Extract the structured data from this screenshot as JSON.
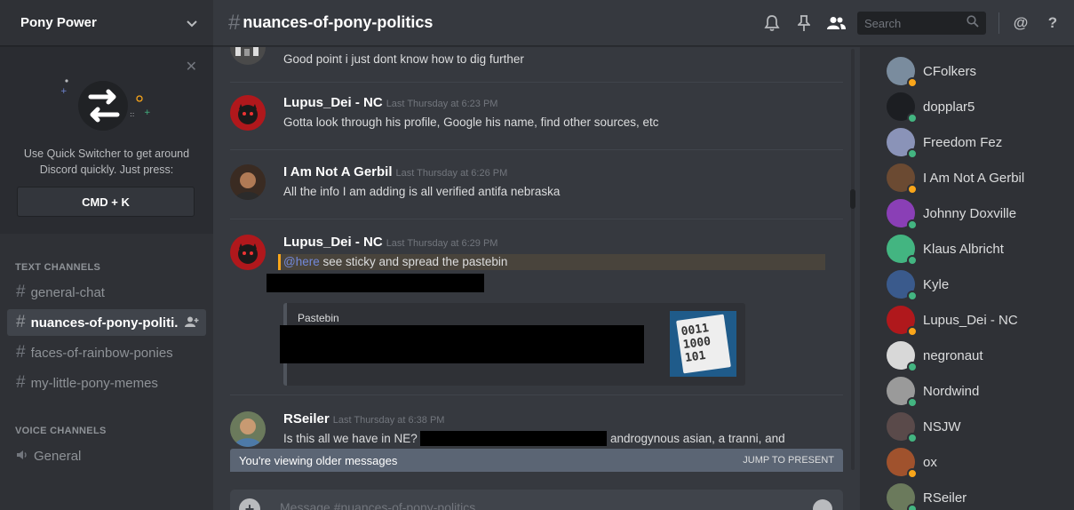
{
  "server": {
    "name": "Pony Power"
  },
  "quick_switcher": {
    "text": "Use Quick Switcher to get around Discord quickly. Just press:",
    "shortcut": "CMD + K"
  },
  "categories": {
    "text": "TEXT CHANNELS",
    "voice": "VOICE CHANNELS"
  },
  "text_channels": [
    {
      "name": "general-chat",
      "active": false
    },
    {
      "name": "nuances-of-pony-politi...",
      "active": true
    },
    {
      "name": "faces-of-rainbow-ponies",
      "active": false
    },
    {
      "name": "my-little-pony-memes",
      "active": false
    }
  ],
  "voice_channels": [
    {
      "name": "General"
    }
  ],
  "header": {
    "hash": "#",
    "channel": "nuances-of-pony-politics",
    "search_placeholder": "Search",
    "icons": [
      "bell-icon",
      "pin-icon",
      "members-icon",
      "search-icon",
      "mention-icon",
      "help-icon"
    ]
  },
  "messages": [
    {
      "author": "",
      "time": "",
      "text": "Good point i just dont know how to dig further",
      "avatar_color": "#5a5a5a"
    },
    {
      "author": "Lupus_Dei - NC",
      "time": "Last Thursday at 6:23 PM",
      "text": "Gotta look through his profile, Google his name, find other sources, etc",
      "avatar_color": "#b0181c"
    },
    {
      "author": "I Am Not A Gerbil",
      "time": "Last Thursday at 6:26 PM",
      "text": "All the info I am adding is all verified antifa nebraska",
      "avatar_color": "#6b4a32"
    },
    {
      "author": "Lupus_Dei - NC",
      "time": "Last Thursday at 6:29 PM",
      "mention": "@here",
      "text": " see sticky and spread the pastebin",
      "avatar_color": "#b0181c",
      "embed": {
        "provider": "Pastebin",
        "thumb_text": [
          "0011",
          "1000",
          "101"
        ]
      }
    },
    {
      "author": "RSeiler",
      "time": "Last Thursday at 6:38 PM",
      "text_before": "Is this all we have in NE?",
      "text_after": "androgynous asian, a tranni, and",
      "avatar_color": "#6b7a5c"
    }
  ],
  "older_bar": {
    "text": "You're viewing older messages",
    "jump": "JUMP TO PRESENT"
  },
  "composer": {
    "placeholder": "Message #nuances-of-pony-politics"
  },
  "members": [
    {
      "name": "CFolkers",
      "status": "idle",
      "avatar": "#7a8c9e"
    },
    {
      "name": "dopplar5",
      "status": "online",
      "avatar": "#1c1e22"
    },
    {
      "name": "Freedom Fez",
      "status": "online",
      "avatar": "#8a93b8"
    },
    {
      "name": "I Am Not A Gerbil",
      "status": "idle",
      "avatar": "#6b4a32"
    },
    {
      "name": "Johnny Doxville",
      "status": "online",
      "avatar": "#8a3fb6"
    },
    {
      "name": "Klaus Albricht",
      "status": "online",
      "avatar": "#43b581"
    },
    {
      "name": "Kyle",
      "status": "online",
      "avatar": "#3a5a8c"
    },
    {
      "name": "Lupus_Dei - NC",
      "status": "idle",
      "avatar": "#b0181c"
    },
    {
      "name": "negronaut",
      "status": "online",
      "avatar": "#d8d8d8"
    },
    {
      "name": "Nordwind",
      "status": "online",
      "avatar": "#9a9a9a"
    },
    {
      "name": "NSJW",
      "status": "online",
      "avatar": "#5a4a4a"
    },
    {
      "name": "ox",
      "status": "idle",
      "avatar": "#a0522d"
    },
    {
      "name": "RSeiler",
      "status": "online",
      "avatar": "#6b7a5c"
    }
  ],
  "status_colors": {
    "online": "#43b581",
    "idle": "#faa61a"
  }
}
